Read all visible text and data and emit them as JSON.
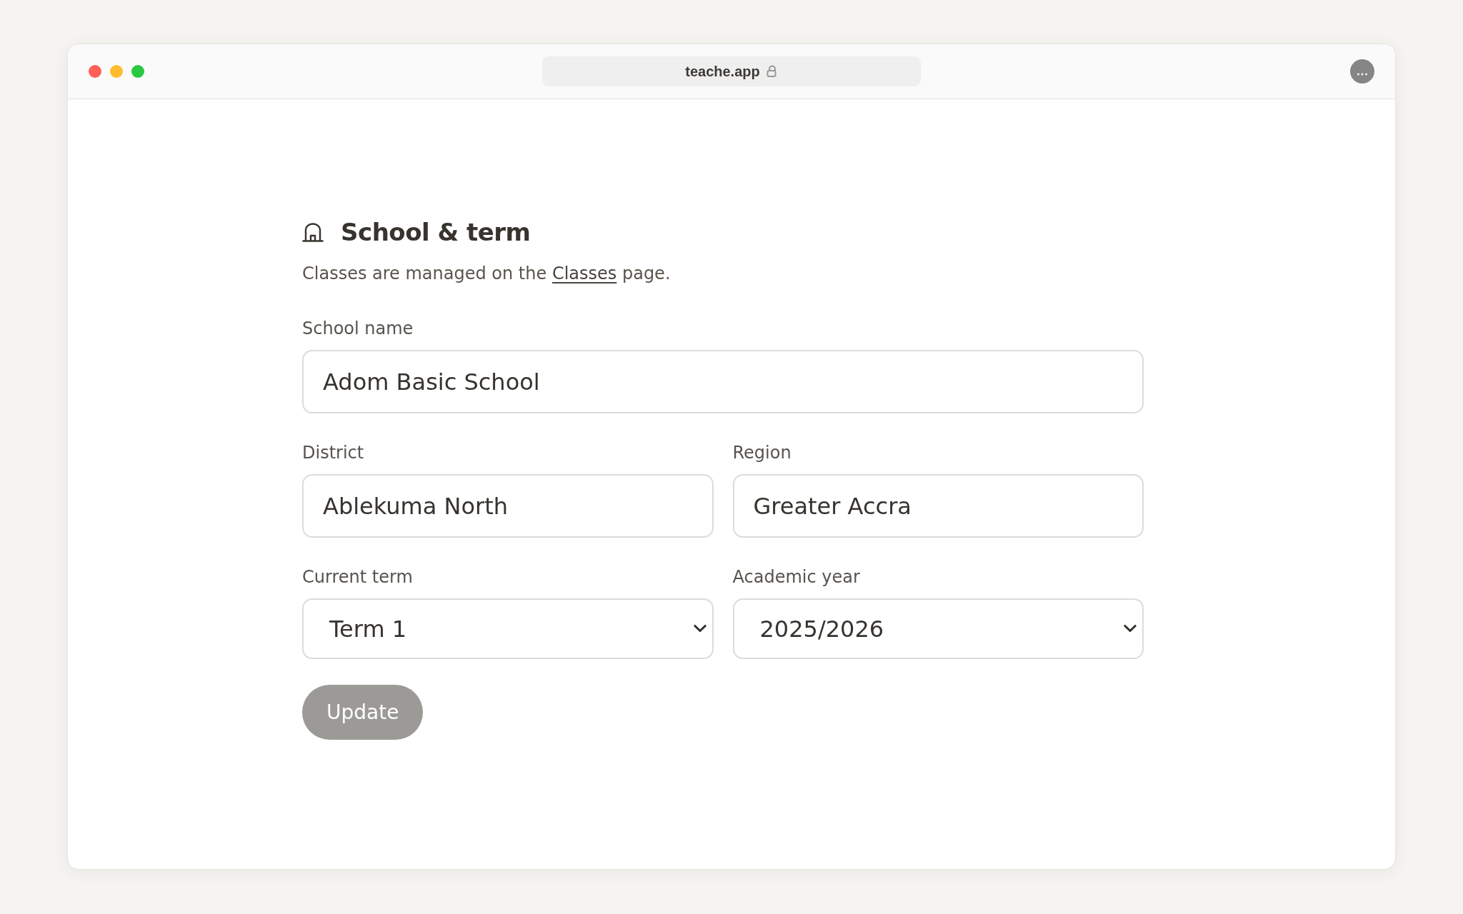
{
  "browser": {
    "address": "teache.app"
  },
  "section": {
    "title": "School & term",
    "description": {
      "text_before": "Classes are managed on the ",
      "link": "Classes",
      "text_after": " page."
    }
  },
  "form": {
    "rows": [
      {
        "fields": [
          {
            "label": "School name",
            "kind": "text",
            "value": "Adom Basic School"
          }
        ]
      },
      {
        "fields": [
          {
            "label": "District",
            "kind": "text",
            "value": "Ablekuma North"
          },
          {
            "label": "Region",
            "kind": "text",
            "value": "Greater Accra"
          }
        ]
      },
      {
        "fields": [
          {
            "label": "Current term",
            "kind": "select",
            "value": "Term 1"
          },
          {
            "label": "Academic year",
            "kind": "select",
            "value": "2025/2026"
          }
        ]
      }
    ],
    "submit": {
      "label": "Update",
      "disabled": true
    }
  }
}
